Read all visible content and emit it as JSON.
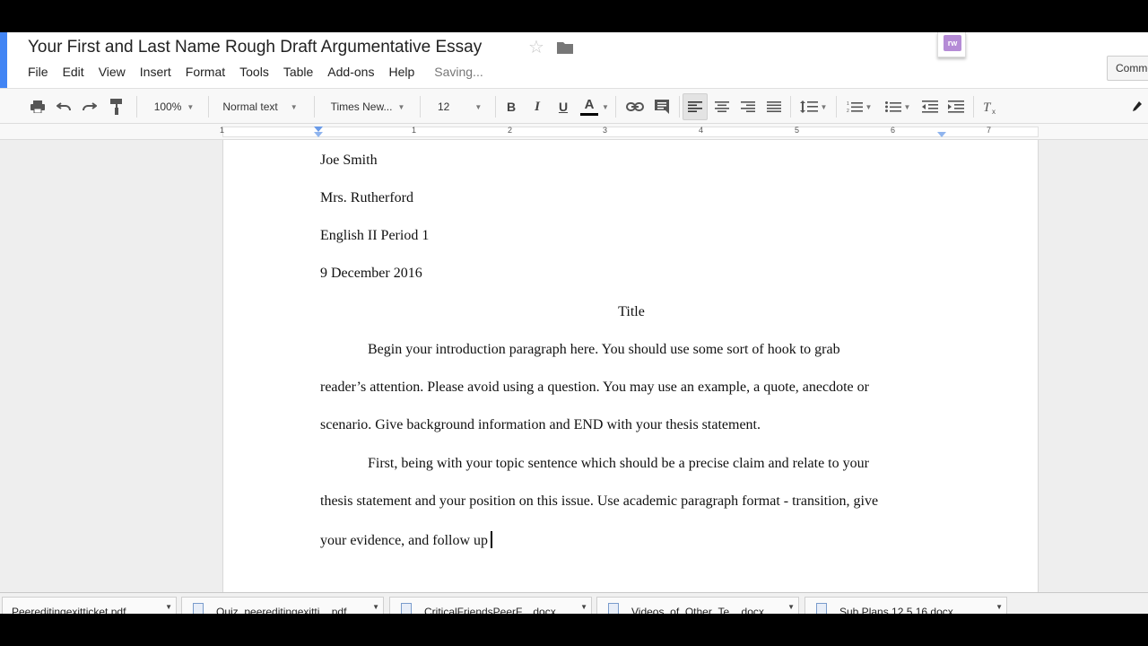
{
  "document": {
    "title": "Your First and Last Name Rough Draft Argumentative Essay",
    "status": "Saving..."
  },
  "menu": [
    "File",
    "Edit",
    "View",
    "Insert",
    "Format",
    "Tools",
    "Table",
    "Add-ons",
    "Help"
  ],
  "addon": {
    "label": "rw"
  },
  "comments_button": {
    "label": "Comments"
  },
  "toolbar": {
    "zoom": "100%",
    "style": "Normal text",
    "font": "Times New...",
    "size": "12",
    "icons": [
      "print-icon",
      "undo-icon",
      "redo-icon",
      "paint-format-icon",
      "bold-icon",
      "italic-icon",
      "underline-icon",
      "text-color-icon",
      "link-icon",
      "comment-icon",
      "align-left-icon",
      "align-center-icon",
      "align-right-icon",
      "justify-icon",
      "line-spacing-icon",
      "numbered-list-icon",
      "bulleted-list-icon",
      "decrease-indent-icon",
      "increase-indent-icon",
      "clear-formatting-icon"
    ],
    "bold_label": "B",
    "italic_label": "I",
    "underline_label": "U",
    "text_color_label": "A",
    "text_color": "#000000"
  },
  "ruler": {
    "labels": [
      "1",
      "1",
      "2",
      "3",
      "4",
      "5",
      "6",
      "7"
    ]
  },
  "page": {
    "header_lines": [
      "Joe Smith",
      "Mrs. Rutherford",
      "English II Period 1",
      "9 December 2016"
    ],
    "title": "Title",
    "paragraph1": [
      "Begin your introduction paragraph here.  You should use some sort of hook to grab",
      "reader’s attention. Please avoid using a question. You may use an example, a quote, anecdote or",
      "scenario. Give background information and END with your thesis statement."
    ],
    "paragraph2": [
      "First, being with your topic sentence which should be a precise claim and relate to your",
      "thesis statement and your position on this issue. Use academic paragraph format - transition, give",
      "your evidence, and follow up"
    ]
  },
  "downloads": [
    "Peereditingexitticket.pdf",
    "Quiz_peereditingexitti....pdf",
    "CriticalFriendsPeerF....docx",
    "Videos_of_Other_Te....docx",
    "Sub Plans 12.5.16.docx"
  ],
  "colors": {
    "accent": "#4285f4",
    "addon": "#b58bd6"
  }
}
